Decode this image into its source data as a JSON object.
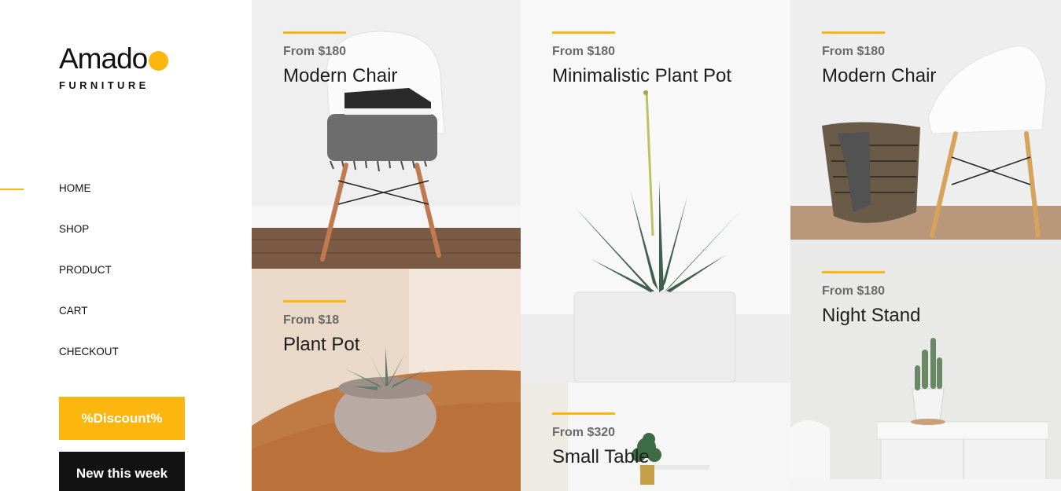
{
  "brand": {
    "name": "Amado",
    "tagline": "FURNITURE",
    "accent_color": "#fbb710"
  },
  "nav": {
    "active": "HOME",
    "items": [
      {
        "label": "HOME"
      },
      {
        "label": "SHOP"
      },
      {
        "label": "PRODUCT"
      },
      {
        "label": "CART"
      },
      {
        "label": "CHECKOUT"
      }
    ]
  },
  "buttons": {
    "discount": "%Discount%",
    "new_this_week": "New this week"
  },
  "products": [
    {
      "price": "From $180",
      "name": "Modern Chair",
      "image": "white chair with shoes and blanket"
    },
    {
      "price": "From $18",
      "name": "Plant Pot",
      "image": "succulent in ceramic pot on wooden table"
    },
    {
      "price": "From $180",
      "name": "Minimalistic Plant Pot",
      "image": "aloe plant in white pot"
    },
    {
      "price": "From $320",
      "name": "Small Table",
      "image": "small table with plant"
    },
    {
      "price": "From $180",
      "name": "Modern Chair",
      "image": "white chair with wicker basket"
    },
    {
      "price": "From $180",
      "name": "Night Stand",
      "image": "white night stand with cactus"
    }
  ]
}
